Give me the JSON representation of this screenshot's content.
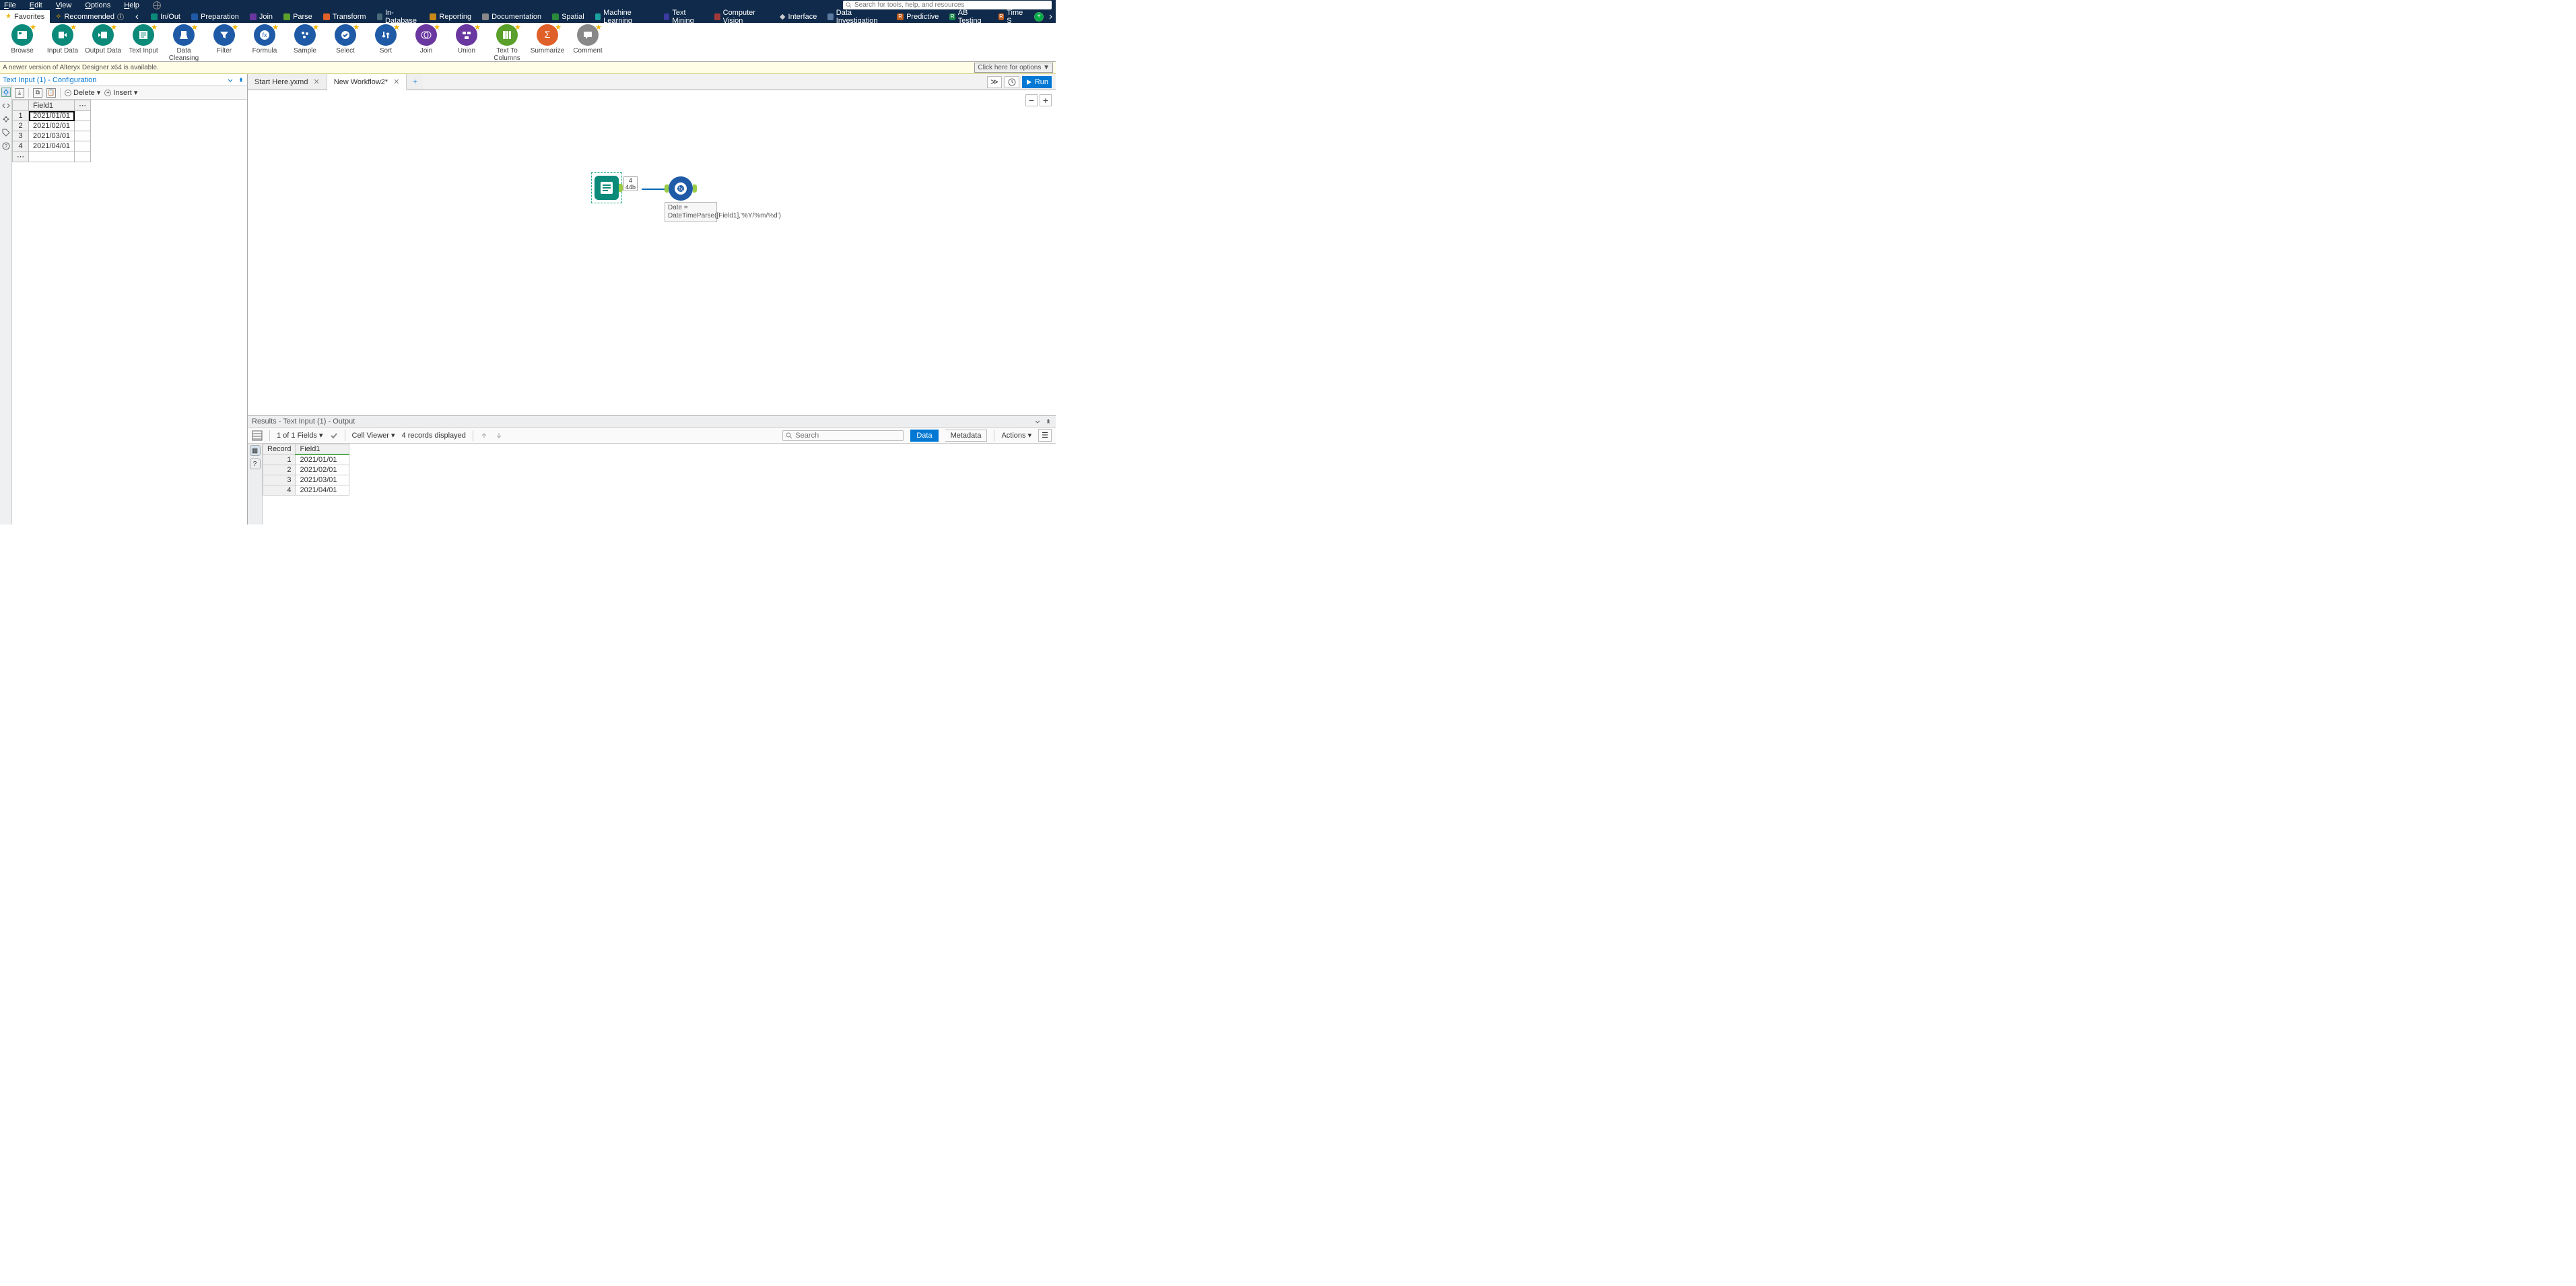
{
  "menu": {
    "file": "File",
    "edit": "Edit",
    "view": "View",
    "options": "Options",
    "help": "Help"
  },
  "search_placeholder": "Search for tools, help, and resources",
  "categories": {
    "favorites": "Favorites",
    "recommended": "Recommended",
    "inout": "In/Out",
    "preparation": "Preparation",
    "join": "Join",
    "parse": "Parse",
    "transform": "Transform",
    "indb": "In-Database",
    "reporting": "Reporting",
    "documentation": "Documentation",
    "spatial": "Spatial",
    "ml": "Machine Learning",
    "textmining": "Text Mining",
    "cv": "Computer Vision",
    "interface": "Interface",
    "datainv": "Data Investigation",
    "predictive": "Predictive",
    "abtest": "AB Testing",
    "time": "Time S"
  },
  "tools": {
    "browse": "Browse",
    "inputdata": "Input Data",
    "outputdata": "Output Data",
    "textinput": "Text Input",
    "datacleansing": "Data Cleansing",
    "filter": "Filter",
    "formula": "Formula",
    "sample": "Sample",
    "select": "Select",
    "sort": "Sort",
    "join": "Join",
    "union": "Union",
    "texttocol": "Text To Columns",
    "summarize": "Summarize",
    "comment": "Comment"
  },
  "update_msg": "A newer version of Alteryx Designer x64 is available.",
  "update_btn": "Click here for options ▼",
  "config": {
    "title": "Text Input (1) - Configuration",
    "delete": "Delete",
    "insert": "Insert",
    "header": "Field1",
    "rows": [
      "2021/01/01",
      "2021/02/01",
      "2021/03/01",
      "2021/04/01"
    ]
  },
  "tabs": {
    "t1": "Start Here.yxmd",
    "t2": "New Workflow2*"
  },
  "run": "Run",
  "canvas": {
    "rec1": "4",
    "rec2": "44b",
    "annot": "Date = DateTimeParse([Field1],'%Y/%m/%d')"
  },
  "results": {
    "title": "Results - Text Input (1) - Output",
    "fields": "1 of 1 Fields",
    "cellviewer": "Cell Viewer",
    "recdisp": "4 records displayed",
    "search": "Search",
    "data": "Data",
    "metadata": "Metadata",
    "actions": "Actions",
    "ooo": "☰",
    "h_record": "Record",
    "h_field": "Field1",
    "rows": [
      [
        "1",
        "2021/01/01"
      ],
      [
        "2",
        "2021/02/01"
      ],
      [
        "3",
        "2021/03/01"
      ],
      [
        "4",
        "2021/04/01"
      ]
    ]
  }
}
